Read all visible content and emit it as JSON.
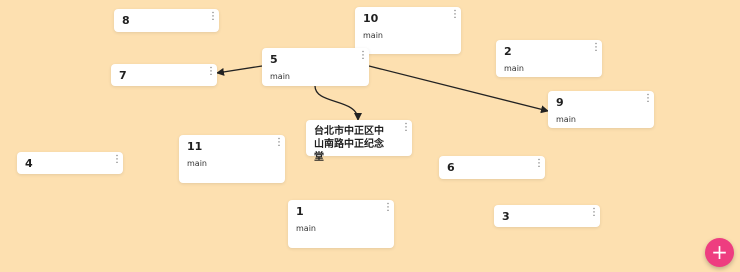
{
  "nodes": [
    {
      "id": "8",
      "title": "8",
      "subtitle": ""
    },
    {
      "id": "10",
      "title": "10",
      "subtitle": "main"
    },
    {
      "id": "2",
      "title": "2",
      "subtitle": "main"
    },
    {
      "id": "7",
      "title": "7",
      "subtitle": ""
    },
    {
      "id": "5",
      "title": "5",
      "subtitle": "main"
    },
    {
      "id": "9",
      "title": "9",
      "subtitle": "main"
    },
    {
      "id": "memorial",
      "title": "台北市中正区中山南路中正纪念堂",
      "subtitle": ""
    },
    {
      "id": "11",
      "title": "11",
      "subtitle": "main"
    },
    {
      "id": "4",
      "title": "4",
      "subtitle": ""
    },
    {
      "id": "6",
      "title": "6",
      "subtitle": ""
    },
    {
      "id": "1",
      "title": "1",
      "subtitle": "main"
    },
    {
      "id": "3",
      "title": "3",
      "subtitle": ""
    }
  ],
  "edges": [
    {
      "from": "5",
      "to": "7"
    },
    {
      "from": "5",
      "to": "memorial"
    },
    {
      "from": "5",
      "to": "9"
    }
  ],
  "fab": {
    "label": "+"
  },
  "colors": {
    "canvas_background": "#fde0b0",
    "node_background": "#ffffff",
    "edge": "#222222",
    "fab": "#ee3d80"
  },
  "icons": {
    "node_menu": "vertical-ellipsis-icon",
    "fab": "plus-icon"
  }
}
